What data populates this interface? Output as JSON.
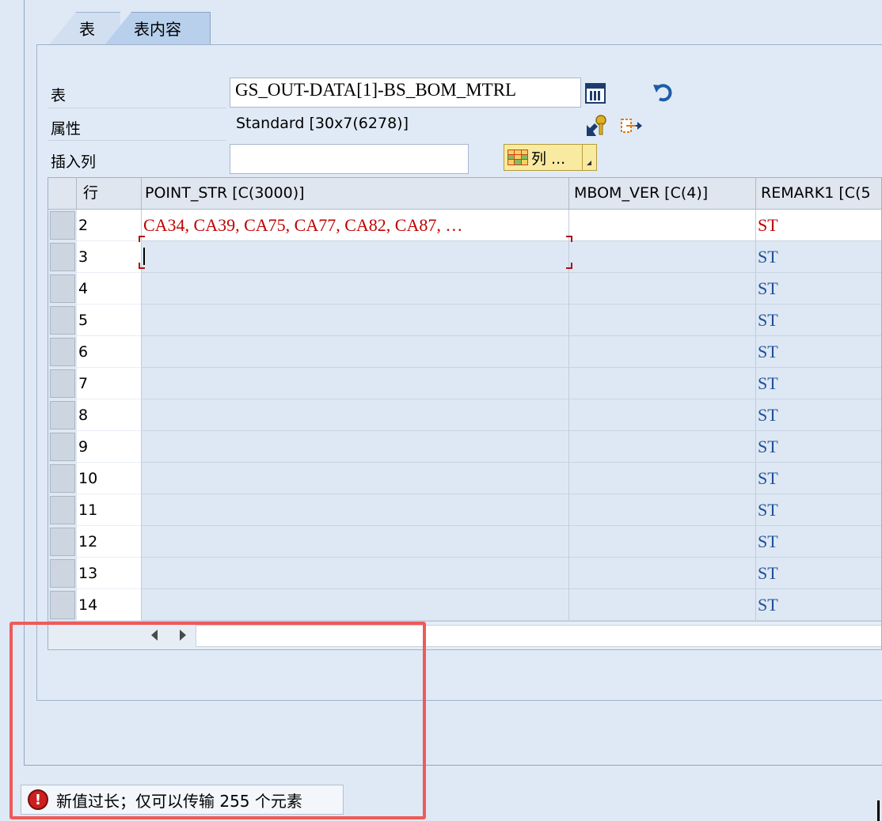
{
  "tabs": [
    {
      "label": "表",
      "active": false
    },
    {
      "label": "表内容",
      "active": true
    }
  ],
  "form": {
    "table_label": "表",
    "table_value": "GS_OUT-DATA[1]-BS_BOM_MTRL",
    "attr_label": "属性",
    "attr_value": "Standard [30x7(6278)]",
    "insert_col_label": "插入列",
    "insert_col_value": "",
    "columns_button_label": "列 ..."
  },
  "grid": {
    "headers": [
      "行",
      "POINT_STR [C(3000)]",
      "MBOM_VER [C(4)]",
      "REMARK1 [C(5"
    ],
    "rows": [
      {
        "row": "2",
        "point_str": "CA34, CA39, CA75, CA77, CA82, CA87, …",
        "mbom_ver": "",
        "remark1": "ST"
      },
      {
        "row": "3",
        "point_str": "",
        "mbom_ver": "",
        "remark1": "ST"
      },
      {
        "row": "4",
        "point_str": "",
        "mbom_ver": "",
        "remark1": "ST"
      },
      {
        "row": "5",
        "point_str": "",
        "mbom_ver": "",
        "remark1": "ST"
      },
      {
        "row": "6",
        "point_str": "",
        "mbom_ver": "",
        "remark1": "ST"
      },
      {
        "row": "7",
        "point_str": "",
        "mbom_ver": "",
        "remark1": "ST"
      },
      {
        "row": "8",
        "point_str": "",
        "mbom_ver": "",
        "remark1": "ST"
      },
      {
        "row": "9",
        "point_str": "",
        "mbom_ver": "",
        "remark1": "ST"
      },
      {
        "row": "10",
        "point_str": "",
        "mbom_ver": "",
        "remark1": "ST"
      },
      {
        "row": "11",
        "point_str": "",
        "mbom_ver": "",
        "remark1": "ST"
      },
      {
        "row": "12",
        "point_str": "",
        "mbom_ver": "",
        "remark1": "ST"
      },
      {
        "row": "13",
        "point_str": "",
        "mbom_ver": "",
        "remark1": "ST"
      },
      {
        "row": "14",
        "point_str": "",
        "mbom_ver": "",
        "remark1": "ST"
      }
    ]
  },
  "status": {
    "message": "新值过长；仅可以传输 255 个元素",
    "icon": "error-icon"
  },
  "colors": {
    "error_text": "#c00000",
    "remark_text": "#1f4f9a",
    "annotation": "#ee5a5a",
    "cols_button_bg": "#f8eaa0"
  }
}
